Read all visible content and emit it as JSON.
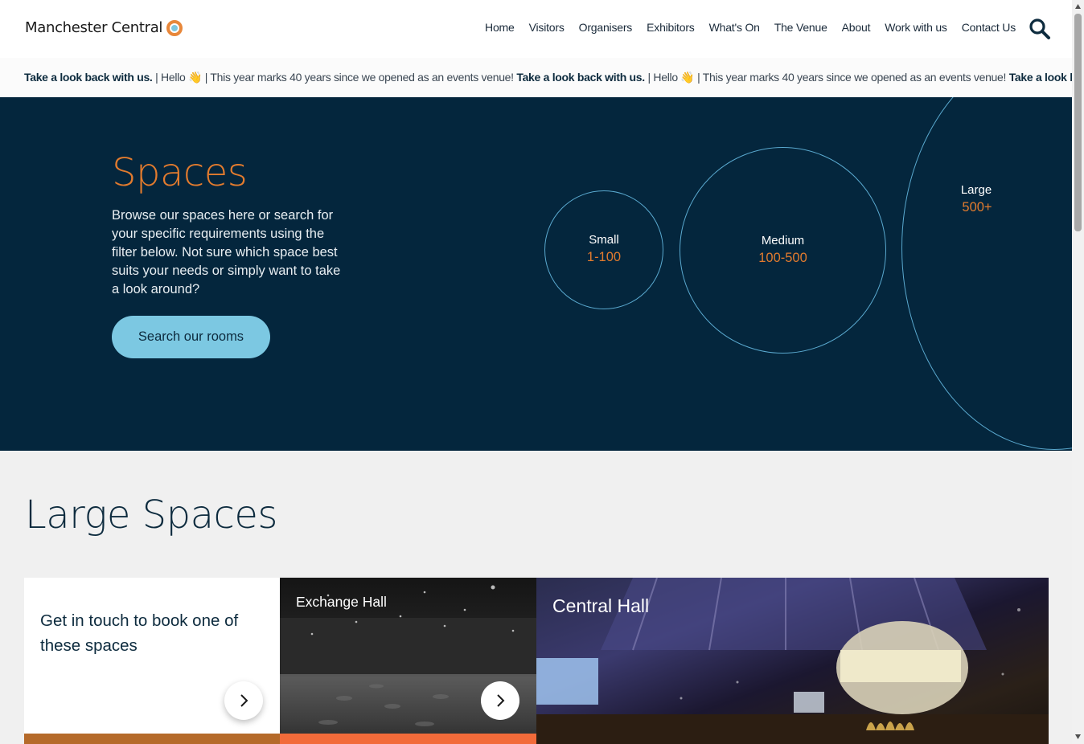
{
  "header": {
    "logo_text": "Manchester Central",
    "nav": [
      "Home",
      "Visitors",
      "Organisers",
      "Exhibitors",
      "What's On",
      "The Venue",
      "About",
      "Work with us",
      "Contact Us"
    ]
  },
  "ticker": {
    "items": [
      {
        "bold": "Take a look back with us.",
        "rest": " | Hello 👋 | This year marks 40 years since we opened as an events venue! "
      },
      {
        "bold": "Take a look back with us.",
        "rest": "  | Hello 👋 | This year marks 40 years since we opened as an events venue! "
      },
      {
        "bold": "Take a look back with us.",
        "rest": ""
      }
    ]
  },
  "hero": {
    "title": "Spaces",
    "description": "Browse our spaces here or search for your specific requirements using the filter below. Not sure which space best suits your needs or simply want to take a look around?",
    "button": "Search our rooms",
    "sizes": [
      {
        "label": "Small",
        "range": "1-100"
      },
      {
        "label": "Medium",
        "range": "100-500"
      },
      {
        "label": "Large",
        "range": "500+"
      }
    ]
  },
  "section": {
    "title": "Large Spaces",
    "cards": {
      "touch": "Get in touch to book one of these spaces",
      "exchange": "Exchange Hall",
      "central": "Central Hall"
    }
  },
  "colors": {
    "hero_bg": "#04263d",
    "accent_orange": "#e27b2e",
    "button_blue": "#7cc8e2",
    "circle_stroke": "#5aa9cf"
  }
}
